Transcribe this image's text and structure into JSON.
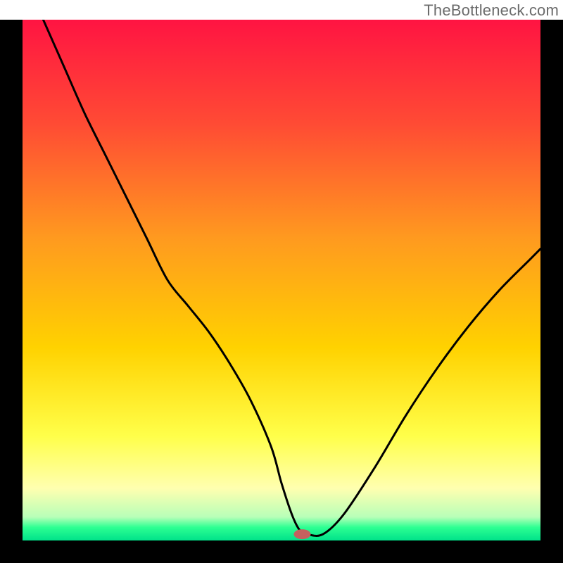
{
  "watermark": "TheBottleneck.com",
  "chart_data": {
    "type": "line",
    "title": "",
    "xlabel": "",
    "ylabel": "",
    "xlim": [
      0,
      100
    ],
    "ylim": [
      0,
      100
    ],
    "grid": false,
    "legend": false,
    "gradient_stops": [
      {
        "offset": 0.0,
        "color": "#ff1442"
      },
      {
        "offset": 0.2,
        "color": "#ff4b34"
      },
      {
        "offset": 0.42,
        "color": "#ff9a1f"
      },
      {
        "offset": 0.63,
        "color": "#ffd200"
      },
      {
        "offset": 0.8,
        "color": "#ffff4a"
      },
      {
        "offset": 0.9,
        "color": "#ffffb0"
      },
      {
        "offset": 0.955,
        "color": "#b8ffb8"
      },
      {
        "offset": 0.975,
        "color": "#2cff92"
      },
      {
        "offset": 1.0,
        "color": "#00e28a"
      }
    ],
    "series": [
      {
        "name": "bottleneck-curve",
        "x": [
          4,
          8,
          12,
          16,
          20,
          24,
          28,
          32,
          36,
          40,
          44,
          48,
          50,
          52,
          53.5,
          55,
          58,
          62,
          68,
          74,
          80,
          86,
          92,
          98,
          100
        ],
        "y": [
          100,
          91,
          82,
          74,
          66,
          58,
          50,
          45,
          40,
          34,
          27,
          18,
          11,
          5,
          2,
          1.2,
          1.2,
          5,
          14,
          24,
          33,
          41,
          48,
          54,
          56
        ]
      }
    ],
    "marker": {
      "x": 54,
      "y": 1.2,
      "color": "#c4615f",
      "rx": 12,
      "ry": 7
    }
  }
}
